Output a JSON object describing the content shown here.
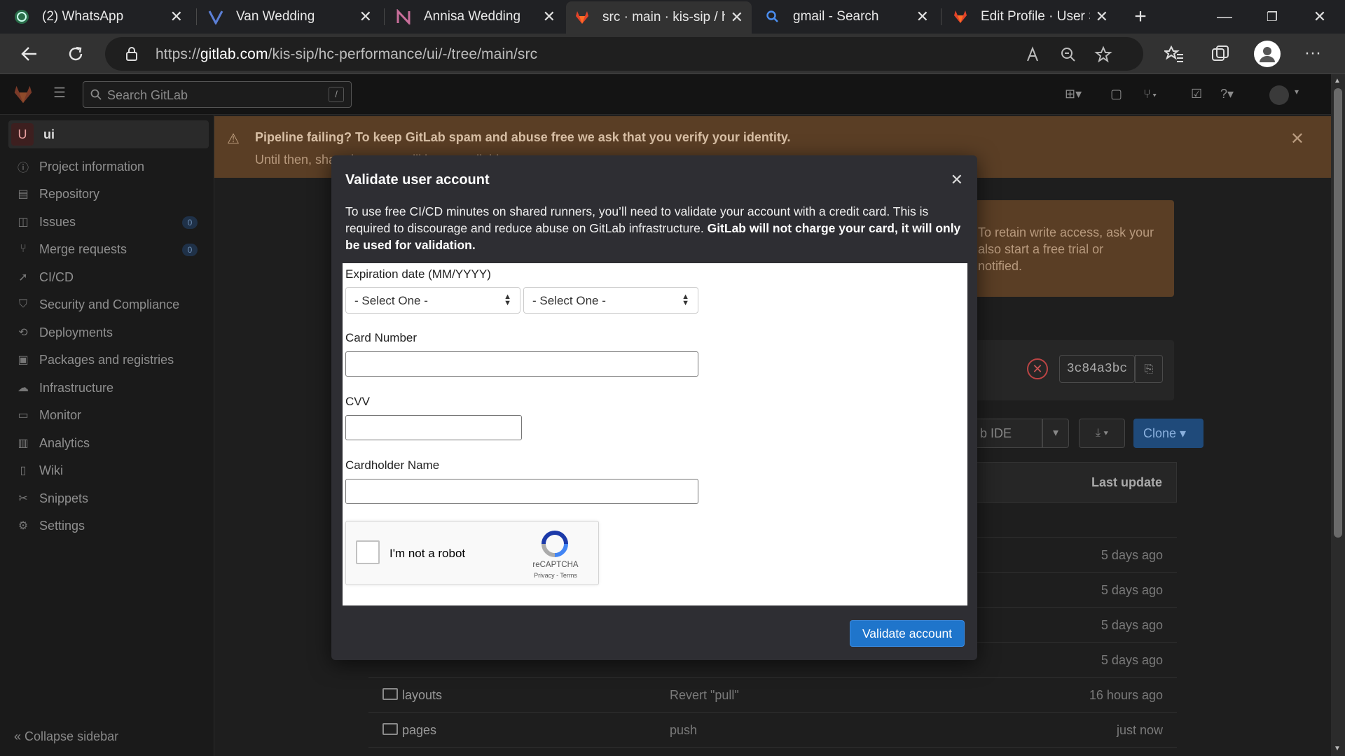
{
  "browser": {
    "tabs": [
      {
        "title": "(2) WhatsApp",
        "icon": "whatsapp-icon"
      },
      {
        "title": "Van Wedding",
        "icon": "v-logo-icon"
      },
      {
        "title": "Annisa Wedding",
        "icon": "n-logo-icon"
      },
      {
        "title": "src · main · kis-sip / h",
        "icon": "gitlab-icon",
        "active": true
      },
      {
        "title": "gmail - Search",
        "icon": "search-icon"
      },
      {
        "title": "Edit Profile · User Set",
        "icon": "gitlab-icon"
      }
    ],
    "url_prefix": "https://",
    "url_domain": "gitlab.com",
    "url_path": "/kis-sip/hc-performance/ui/-/tree/main/src"
  },
  "gitlab": {
    "search_placeholder": "Search GitLab",
    "search_shortcut": "/",
    "project_initial": "U",
    "project_name": "ui",
    "sidebar": [
      {
        "label": "Project information",
        "icon": "info-icon"
      },
      {
        "label": "Repository",
        "icon": "doc-icon"
      },
      {
        "label": "Issues",
        "icon": "issues-icon",
        "badge": "0"
      },
      {
        "label": "Merge requests",
        "icon": "merge-icon",
        "badge": "0"
      },
      {
        "label": "CI/CD",
        "icon": "rocket-icon"
      },
      {
        "label": "Security and Compliance",
        "icon": "shield-icon"
      },
      {
        "label": "Deployments",
        "icon": "deploy-icon"
      },
      {
        "label": "Packages and registries",
        "icon": "package-icon"
      },
      {
        "label": "Infrastructure",
        "icon": "cloud-icon"
      },
      {
        "label": "Monitor",
        "icon": "monitor-icon"
      },
      {
        "label": "Analytics",
        "icon": "chart-icon"
      },
      {
        "label": "Wiki",
        "icon": "book-icon"
      },
      {
        "label": "Snippets",
        "icon": "scissors-icon"
      },
      {
        "label": "Settings",
        "icon": "gear-icon"
      }
    ],
    "collapse_label": "Collapse sidebar",
    "alert_title": "Pipeline failing? To keep GitLab spam and abuse free we ask that you verify your identity.",
    "alert_body": "Until then, shared runners will be unavailable.",
    "alert2_lines": [
      "To retain write access, ask your",
      "also start a free trial or",
      "notified."
    ],
    "commit_sha": "3c84a3bc",
    "web_ide_label": "b IDE",
    "clone_label": "Clone",
    "last_update_header": "Last update",
    "files": [
      {
        "name": "",
        "commit": "",
        "updated": "5 days ago"
      },
      {
        "name": "",
        "commit": "",
        "updated": "5 days ago"
      },
      {
        "name": "",
        "commit": "",
        "updated": "5 days ago"
      },
      {
        "name": "",
        "commit": "",
        "updated": "5 days ago"
      },
      {
        "name": "layouts",
        "commit": "Revert \"pull\"",
        "updated": "16 hours ago"
      },
      {
        "name": "pages",
        "commit": "push",
        "updated": "just now"
      }
    ]
  },
  "modal": {
    "title": "Validate user account",
    "desc_plain": "To use free CI/CD minutes on shared runners, you’ll need to validate your account with a credit card. This is required to discourage and reduce abuse on GitLab infrastructure. ",
    "desc_bold": "GitLab will not charge your card, it will only be used for validation.",
    "expiry_label": "Expiration date (MM/YYYY)",
    "month_select": "- Select One -",
    "year_select": "- Select One -",
    "card_label": "Card Number",
    "card_value": "",
    "cvv_label": "CVV",
    "cvv_value": "",
    "holder_label": "Cardholder Name",
    "holder_value": "",
    "recaptcha_text": "I'm not a robot",
    "recaptcha_brand": "reCAPTCHA",
    "recaptcha_links": "Privacy - Terms",
    "submit_label": "Validate account"
  }
}
